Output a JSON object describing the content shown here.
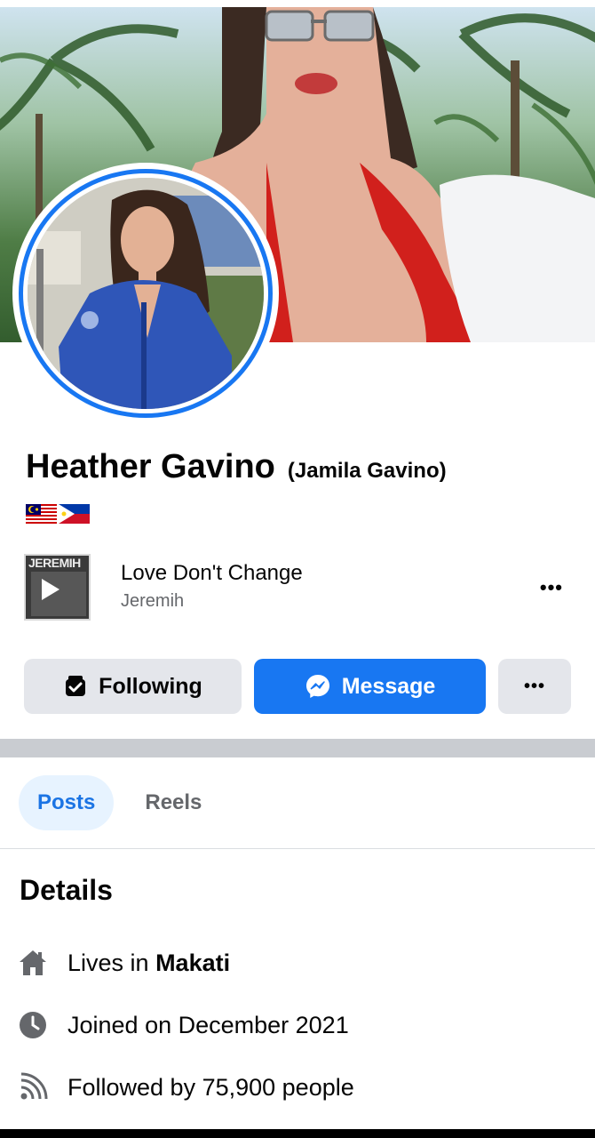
{
  "profile": {
    "name": "Heather Gavino",
    "alternate_name": "(Jamila Gavino)",
    "flags": [
      "malaysia-flag",
      "philippines-flag"
    ]
  },
  "music": {
    "album_text": "JEREMIH",
    "song": "Love Don't Change",
    "artist": "Jeremih",
    "more": "•••"
  },
  "actions": {
    "following_label": "Following",
    "message_label": "Message",
    "more_label": "•••"
  },
  "tabs": [
    {
      "label": "Posts",
      "active": true
    },
    {
      "label": "Reels",
      "active": false
    }
  ],
  "details": {
    "title": "Details",
    "lives_prefix": "Lives in",
    "lives_city": "Makati",
    "joined": "Joined on December 2021",
    "followed": "Followed by 75,900 people"
  },
  "colors": {
    "accent": "#1877f2",
    "tab_active_bg": "#e7f3ff",
    "secondary_button": "#e4e6eb"
  }
}
